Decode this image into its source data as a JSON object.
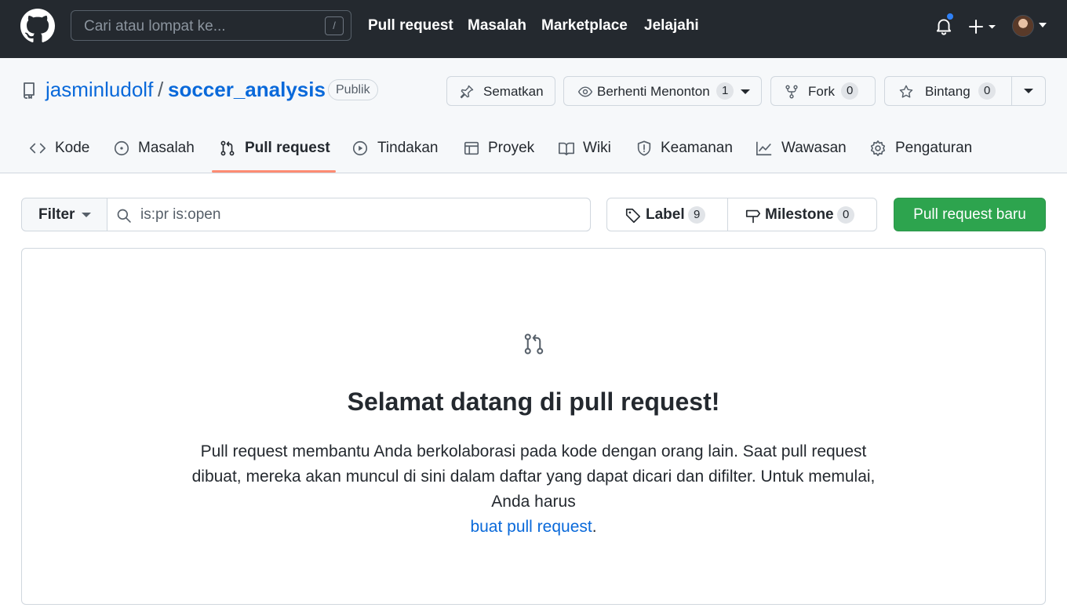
{
  "header": {
    "search_placeholder": "Cari atau lompat ke...",
    "search_shortcut": "/",
    "nav": [
      "Pull request",
      "Masalah",
      "Marketplace",
      "Jelajahi"
    ],
    "notification_dot_color": "#2f81f7"
  },
  "repo": {
    "owner": "jasminludolf",
    "separator": "/",
    "name": "soccer_analysis",
    "visibility": "Publik",
    "actions": {
      "pin_label": "Sematkan",
      "watch_label": "Berhenti Menonton",
      "watch_count": "1",
      "fork_label": "Fork",
      "fork_count": "0",
      "star_label": "Bintang",
      "star_count": "0"
    }
  },
  "tabs": [
    {
      "label": "Kode",
      "icon": "code-icon"
    },
    {
      "label": "Masalah",
      "icon": "issue-icon"
    },
    {
      "label": "Pull request",
      "icon": "git-pull-request-icon",
      "selected": true
    },
    {
      "label": "Tindakan",
      "icon": "play-icon"
    },
    {
      "label": "Proyek",
      "icon": "table-icon"
    },
    {
      "label": "Wiki",
      "icon": "book-icon"
    },
    {
      "label": "Keamanan",
      "icon": "shield-icon"
    },
    {
      "label": "Wawasan",
      "icon": "graph-icon"
    },
    {
      "label": "Pengaturan",
      "icon": "gear-icon"
    }
  ],
  "toolbar": {
    "filter_label": "Filter",
    "filter_query": "is:pr is:open",
    "label_label": "Label",
    "label_count": "9",
    "milestone_label": "Milestone",
    "milestone_count": "0",
    "new_pr_label": "Pull request baru"
  },
  "blankslate": {
    "title": "Selamat datang di pull request!",
    "body": "Pull request membantu Anda berkolaborasi pada kode dengan orang lain. Saat pull request dibuat, mereka akan muncul di sini dalam daftar yang dapat dicari dan difilter. Untuk memulai, Anda harus",
    "link": "buat pull request",
    "end": "."
  },
  "colors": {
    "header_bg": "#24292f",
    "link": "#0969da",
    "primary_button": "#2da44e",
    "tab_underline": "#fd8c73"
  }
}
